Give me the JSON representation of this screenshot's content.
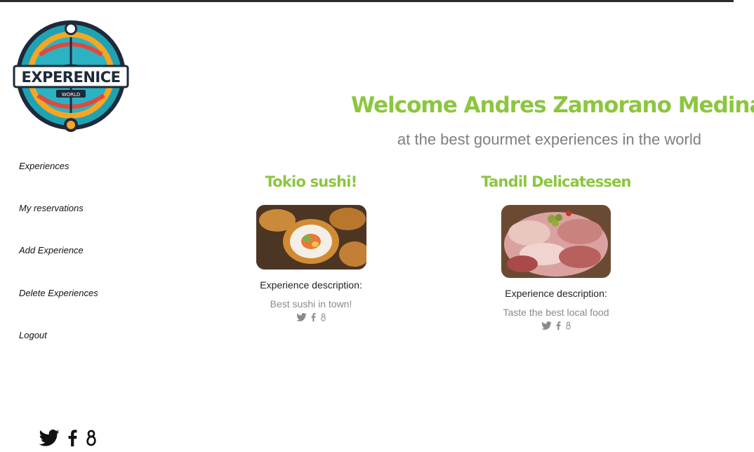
{
  "brand": {
    "logo_text": "EXPERENICE",
    "logo_subtext": "WORLD"
  },
  "nav": {
    "items": [
      {
        "label": "Experiences"
      },
      {
        "label": "My reservations"
      },
      {
        "label": "Add Experience"
      },
      {
        "label": "Delete Experiences"
      },
      {
        "label": "Logout"
      }
    ]
  },
  "hero": {
    "title": "Welcome Andres Zamorano Medina",
    "subtitle": "at the best gourmet experiences in the world"
  },
  "experiences": [
    {
      "title": "Tokio sushi!",
      "description_label": "Experience description:",
      "description": "Best sushi in town!",
      "image_icon": "sushi-roll-photo",
      "share_icons": [
        "twitter-icon",
        "facebook-icon",
        "google-plus-icon"
      ]
    },
    {
      "title": "Tandil Delicatessen",
      "description_label": "Experience description:",
      "description": "Taste the best local food",
      "image_icon": "cold-cuts-platter-photo",
      "share_icons": [
        "twitter-icon",
        "facebook-icon",
        "google-plus-icon"
      ]
    }
  ],
  "footer": {
    "social_icons": [
      "twitter-icon",
      "facebook-icon",
      "google-plus-icon"
    ]
  },
  "colors": {
    "accent_green": "#8cc63f",
    "muted_gray": "#7f7f7f",
    "logo_teal": "#1fa3b3",
    "logo_orange": "#f5a623"
  }
}
